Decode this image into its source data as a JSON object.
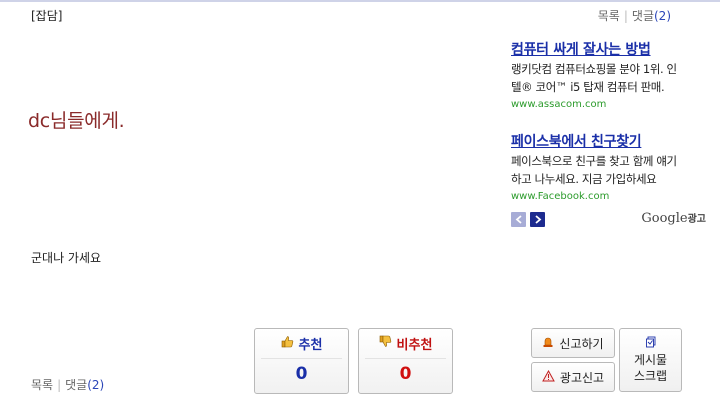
{
  "header": {
    "category": "[잡담]",
    "list_link": "목록",
    "comments_label": "댓글",
    "comments_count": "(2)"
  },
  "post": {
    "title": "dc님들에게.",
    "body": "군대나 가세요"
  },
  "ads": [
    {
      "title": "컴퓨터 싸게 잘사는 방법",
      "desc_line1": "랭키닷컴 컴퓨터쇼핑몰 분야 1위. 인",
      "desc_line2": "텔® 코어™ i5 탑재 컴퓨터 판매.",
      "url": "www.assacom.com"
    },
    {
      "title": "페이스북에서 친구찾기",
      "desc_line1": "페이스북으로 친구를 찾고 함께 얘기",
      "desc_line2": "하고 나누세요. 지금 가입하세요",
      "url": "www.Facebook.com"
    }
  ],
  "ad_branding": {
    "google": "Google",
    "suffix": "광고"
  },
  "votes": {
    "recommend_label": "추천",
    "recommend_count": "0",
    "unrecommend_label": "비추천",
    "unrecommend_count": "0"
  },
  "actions": {
    "report": "신고하기",
    "ad_report": "광고신고",
    "scrap_line1": "게시물",
    "scrap_line2": "스크랩"
  },
  "footer": {
    "list_link": "목록",
    "comments_label": "댓글",
    "comments_count": "(2)"
  },
  "icons": {
    "thumbs_up": "thumbs-up-icon",
    "thumbs_down": "thumbs-down-icon",
    "siren": "siren-icon",
    "warning": "warning-icon",
    "scrap": "scrap-icon",
    "prev": "chevron-left-icon",
    "next": "chevron-right-icon"
  },
  "colors": {
    "link_blue": "#1a2fa8",
    "title_red": "#8a2a2a",
    "vote_red": "#d01010",
    "url_green": "#2c9b2c"
  }
}
